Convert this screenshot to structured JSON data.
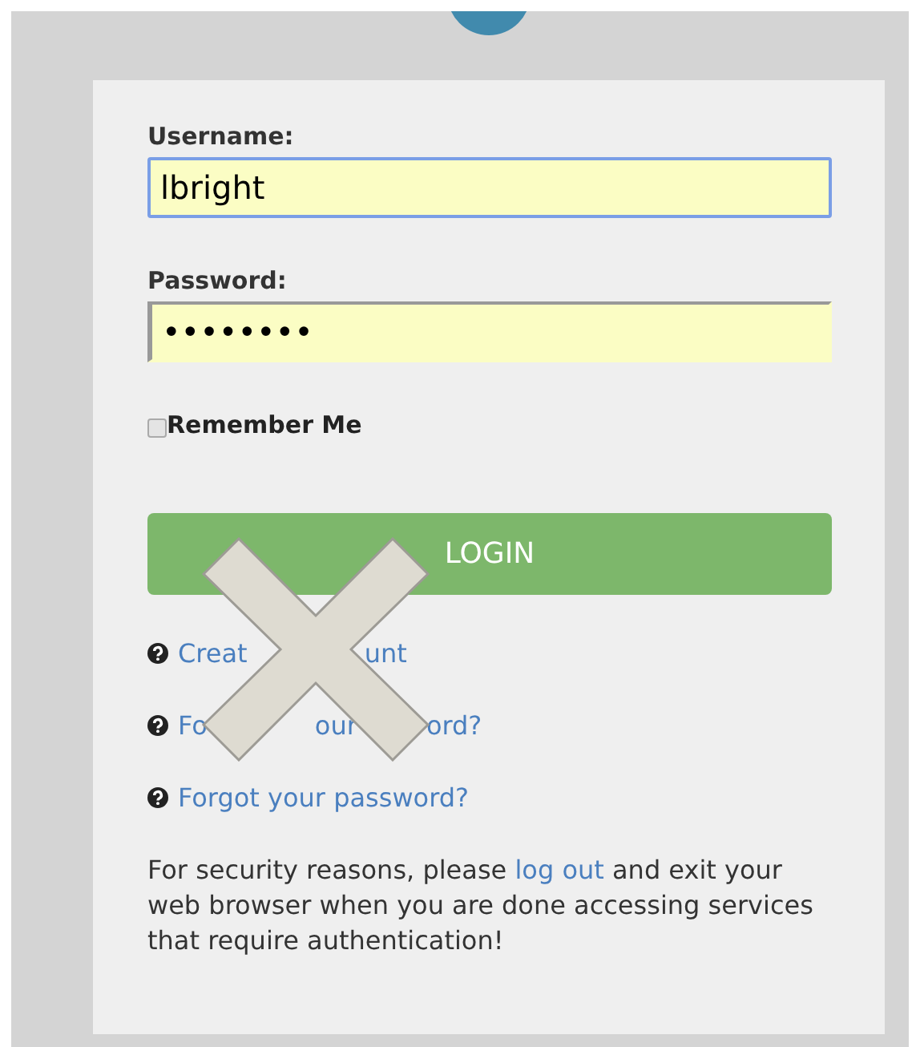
{
  "form": {
    "fields": [
      {
        "label": "Username:",
        "value": "lbright",
        "focused": true
      },
      {
        "label": "Password:",
        "value": "••••••••",
        "focused": false
      }
    ],
    "remember": {
      "label": "Remember Me",
      "checked": false
    },
    "login_button": "LOGIN",
    "links": [
      {
        "fragments": [
          "Creat",
          "unt"
        ]
      },
      {
        "fragments": [
          "Fo",
          "our",
          "ord?"
        ]
      },
      {
        "fragments": [
          "Forgot your password?"
        ]
      }
    ],
    "notice": {
      "before": "For security reasons, please ",
      "link": "log out",
      "after": " and exit your web browser when you are done accessing services that require authentication!"
    }
  }
}
